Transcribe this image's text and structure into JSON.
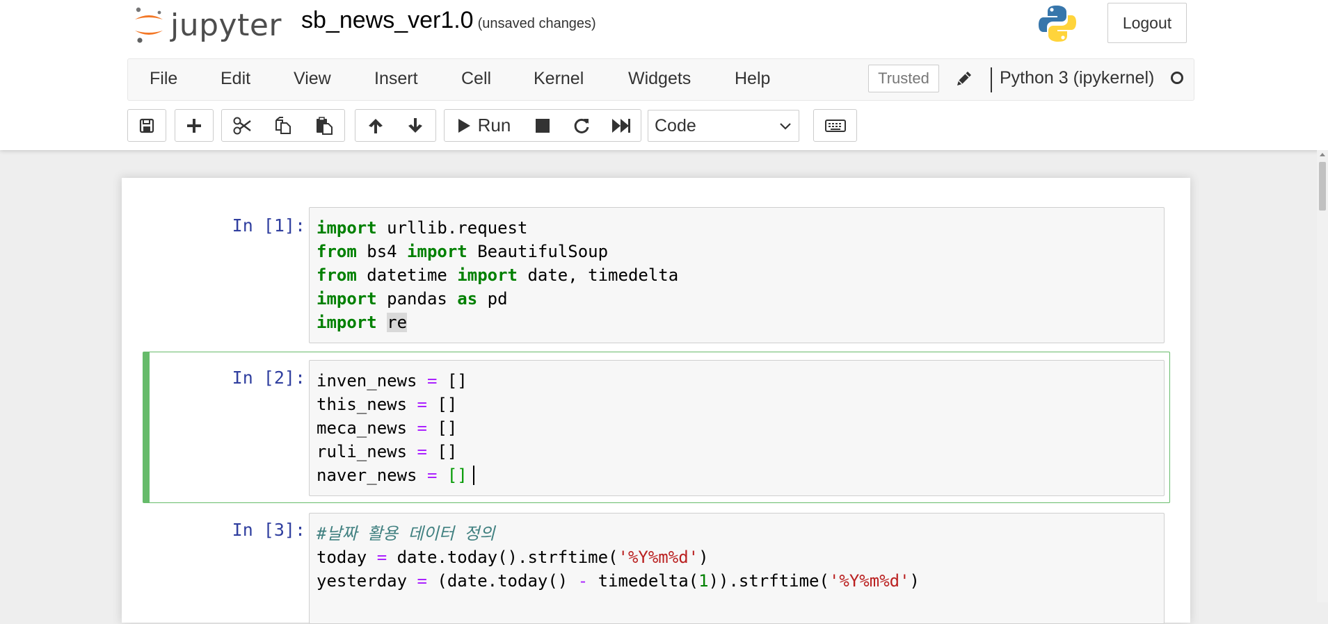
{
  "header": {
    "logo_text": "jupyter",
    "notebook_name": "sb_news_ver1.0",
    "save_status": "(unsaved changes)",
    "logout_label": "Logout"
  },
  "menubar": {
    "items": [
      "File",
      "Edit",
      "View",
      "Insert",
      "Cell",
      "Kernel",
      "Widgets",
      "Help"
    ],
    "trusted_label": "Trusted",
    "kernel_name": "Python 3 (ipykernel)"
  },
  "toolbar": {
    "run_label": "Run",
    "cell_type": "Code",
    "icons": [
      "save-icon",
      "plus-icon",
      "cut-icon",
      "copy-icon",
      "paste-icon",
      "arrow-up-icon",
      "arrow-down-icon",
      "play-icon",
      "stop-icon",
      "restart-icon",
      "fast-forward-icon",
      "keyboard-icon"
    ]
  },
  "cells": [
    {
      "prompt": "In [1]:",
      "lines": [
        [
          [
            "kw",
            "import"
          ],
          [
            "t",
            " urllib.request"
          ]
        ],
        [
          [
            "kw",
            "from"
          ],
          [
            "t",
            " bs4 "
          ],
          [
            "kw",
            "import"
          ],
          [
            "t",
            " BeautifulSoup"
          ]
        ],
        [
          [
            "kw",
            "from"
          ],
          [
            "t",
            " datetime "
          ],
          [
            "kw",
            "import"
          ],
          [
            "t",
            " date, timedelta"
          ]
        ],
        [
          [
            "kw",
            "import"
          ],
          [
            "t",
            " pandas "
          ],
          [
            "kw",
            "as"
          ],
          [
            "t",
            " pd"
          ]
        ],
        [
          [
            "kw",
            "import"
          ],
          [
            "t",
            " "
          ],
          [
            "sel",
            "re"
          ]
        ]
      ]
    },
    {
      "prompt": "In [2]:",
      "lines": [
        [
          [
            "t",
            "inven_news "
          ],
          [
            "op",
            "="
          ],
          [
            "t",
            " []"
          ]
        ],
        [
          [
            "t",
            "this_news "
          ],
          [
            "op",
            "="
          ],
          [
            "t",
            " []"
          ]
        ],
        [
          [
            "t",
            "meca_news "
          ],
          [
            "op",
            "="
          ],
          [
            "t",
            " []"
          ]
        ],
        [
          [
            "t",
            "ruli_news "
          ],
          [
            "op",
            "="
          ],
          [
            "t",
            " []"
          ]
        ],
        [
          [
            "t",
            "naver_news "
          ],
          [
            "op",
            "="
          ],
          [
            "t",
            " "
          ],
          [
            "brk",
            "[]"
          ],
          [
            "cursor",
            ""
          ]
        ]
      ]
    },
    {
      "prompt": "In [3]:",
      "lines": [
        [
          [
            "cm",
            "#날짜 활용 데이터 정의"
          ]
        ],
        [
          [
            "t",
            "today "
          ],
          [
            "op",
            "="
          ],
          [
            "t",
            " date.today().strftime("
          ],
          [
            "str",
            "'%Y%m%d'"
          ],
          [
            "t",
            ")"
          ]
        ],
        [
          [
            "t",
            "yesterday "
          ],
          [
            "op",
            "="
          ],
          [
            "t",
            " (date.today() "
          ],
          [
            "op",
            "-"
          ],
          [
            "t",
            " timedelta("
          ],
          [
            "num",
            "1"
          ],
          [
            "t",
            ")).strftime("
          ],
          [
            "str",
            "'%Y%m%d'"
          ],
          [
            "t",
            ")"
          ]
        ]
      ]
    }
  ],
  "colors": {
    "keyword": "#008000",
    "operator": "#aa22ff",
    "string": "#ba2121",
    "comment": "#408080",
    "prompt": "#303f9f",
    "selected_cell_border": "#66bb6a"
  }
}
